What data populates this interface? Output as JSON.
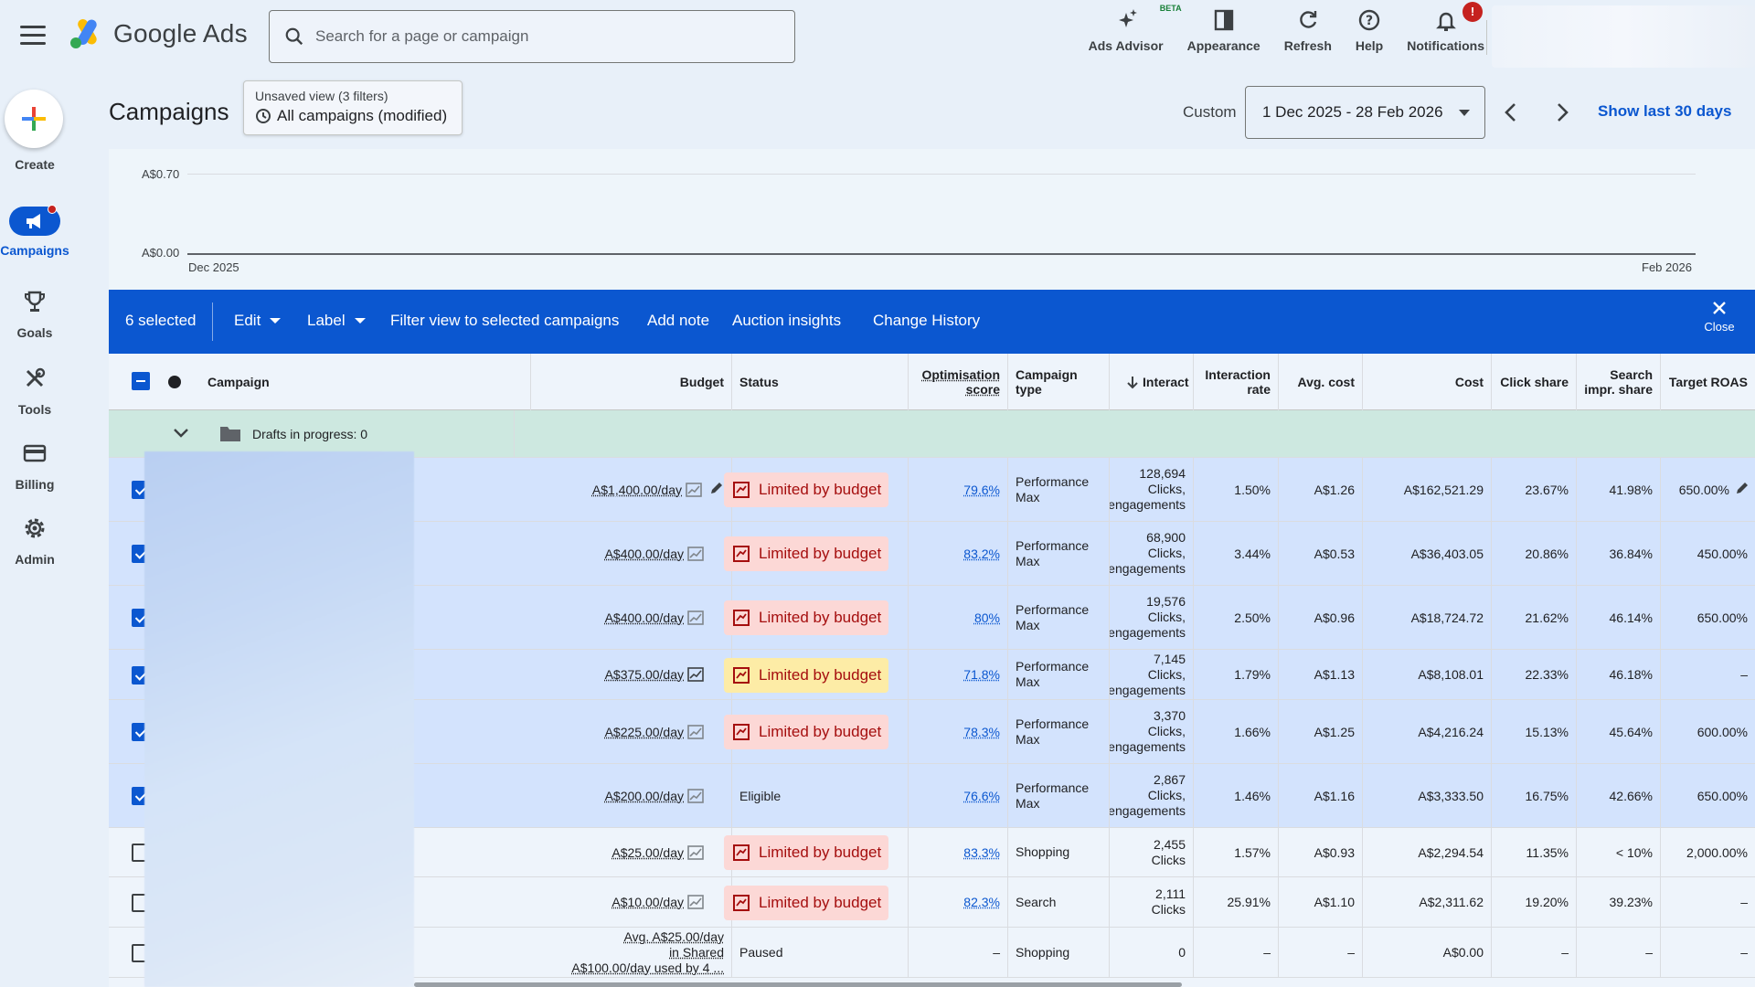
{
  "app": {
    "name": "Google Ads",
    "search_placeholder": "Search for a page or campaign",
    "colors": {
      "accent": "#0b57d0",
      "success": "#137333",
      "error": "#c5221f",
      "drafts_bg": "#cde8e0"
    }
  },
  "top_actions": [
    {
      "label": "Ads Advisor",
      "icon": "sparkle-icon",
      "badge": "BETA"
    },
    {
      "label": "Appearance",
      "icon": "appearance-icon"
    },
    {
      "label": "Refresh",
      "icon": "refresh-icon"
    },
    {
      "label": "Help",
      "icon": "help-icon"
    },
    {
      "label": "Notifications",
      "icon": "bell-icon",
      "badge": "!"
    }
  ],
  "nav": [
    {
      "label": "Create",
      "icon": "plus-icon"
    },
    {
      "label": "Campaigns",
      "icon": "megaphone-icon",
      "active": true
    },
    {
      "label": "Goals",
      "icon": "trophy-icon"
    },
    {
      "label": "Tools",
      "icon": "tools-icon"
    },
    {
      "label": "Billing",
      "icon": "card-icon"
    },
    {
      "label": "Admin",
      "icon": "gear-icon"
    }
  ],
  "header": {
    "title": "Campaigns",
    "view_sub": "Unsaved view (3 filters)",
    "view_main": "All campaigns (modified)",
    "custom_label": "Custom",
    "date_range": "1 Dec 2025 - 28 Feb 2026",
    "show_last": "Show last 30 days"
  },
  "chart": {
    "y_top": "A$0.70",
    "y_bottom": "A$0.00",
    "x_start": "Dec 2025",
    "x_end": "Feb 2026"
  },
  "selection_bar": {
    "count": "6 selected",
    "edit": "Edit",
    "label": "Label",
    "filter": "Filter view to selected campaigns",
    "add_note": "Add note",
    "auction": "Auction insights",
    "history": "Change History",
    "close": "Close"
  },
  "table": {
    "headers": {
      "campaign": "Campaign",
      "budget": "Budget",
      "status": "Status",
      "opt_score_1": "Optimisation",
      "opt_score_2": "score",
      "type_1": "Campaign",
      "type_2": "type",
      "interactions": "Interact",
      "irate_1": "Interaction",
      "irate_2": "rate",
      "avg_cost": "Avg. cost",
      "cost": "Cost",
      "click_share": "Click share",
      "sis_1": "Search",
      "sis_2": "impr. share",
      "troas": "Target ROAS"
    },
    "drafts": "Drafts in progress: 0",
    "rows": [
      {
        "selected": true,
        "budget": "A$1,400.00/day",
        "status": "Limited by budget",
        "status_kind": "error",
        "opt": "79.6%",
        "type": "Performance Max",
        "int_1": "128,694",
        "int_2": "Clicks,",
        "int_3": "engagements",
        "irate": "1.50%",
        "avg": "A$1.26",
        "cost": "A$162,521.29",
        "click_share": "23.67%",
        "sis": "41.98%",
        "troas": "650.00%"
      },
      {
        "selected": true,
        "budget": "A$400.00/day",
        "status": "Limited by budget",
        "status_kind": "error",
        "opt": "83.2%",
        "type": "Performance Max",
        "int_1": "68,900",
        "int_2": "Clicks,",
        "int_3": "engagements",
        "irate": "3.44%",
        "avg": "A$0.53",
        "cost": "A$36,403.05",
        "click_share": "20.86%",
        "sis": "36.84%",
        "troas": "450.00%"
      },
      {
        "selected": true,
        "budget": "A$400.00/day",
        "status": "Limited by budget",
        "status_kind": "error",
        "opt": "80%",
        "type": "Performance Max",
        "int_1": "19,576",
        "int_2": "Clicks,",
        "int_3": "engagements",
        "irate": "2.50%",
        "avg": "A$0.96",
        "cost": "A$18,724.72",
        "click_share": "21.62%",
        "sis": "46.14%",
        "troas": "650.00%"
      },
      {
        "selected": true,
        "budget": "A$375.00/day",
        "status": "Limited by budget",
        "status_kind": "warn",
        "opt": "71.8%",
        "type": "Performance Max",
        "int_1": "7,145",
        "int_2": "Clicks,",
        "int_3": "engagements",
        "irate": "1.79%",
        "avg": "A$1.13",
        "cost": "A$8,108.01",
        "click_share": "22.33%",
        "sis": "46.18%",
        "troas": "–"
      },
      {
        "selected": true,
        "budget": "A$225.00/day",
        "status": "Limited by budget",
        "status_kind": "error",
        "opt": "78.3%",
        "type": "Performance Max",
        "int_1": "3,370",
        "int_2": "Clicks,",
        "int_3": "engagements",
        "irate": "1.66%",
        "avg": "A$1.25",
        "cost": "A$4,216.24",
        "click_share": "15.13%",
        "sis": "45.64%",
        "troas": "600.00%"
      },
      {
        "selected": true,
        "budget": "A$200.00/day",
        "status": "Eligible",
        "status_kind": "plain",
        "opt": "76.6%",
        "type": "Performance Max",
        "int_1": "2,867",
        "int_2": "Clicks,",
        "int_3": "engagements",
        "irate": "1.46%",
        "avg": "A$1.16",
        "cost": "A$3,333.50",
        "click_share": "16.75%",
        "sis": "42.66%",
        "troas": "650.00%"
      },
      {
        "selected": false,
        "budget": "A$25.00/day",
        "status": "Limited by budget",
        "status_kind": "error",
        "opt": "83.3%",
        "type": "Shopping",
        "int_1": "2,455",
        "int_2": "Clicks",
        "int_3": "",
        "irate": "1.57%",
        "avg": "A$0.93",
        "cost": "A$2,294.54",
        "click_share": "11.35%",
        "sis": "< 10%",
        "troas": "2,000.00%"
      },
      {
        "selected": false,
        "budget": "A$10.00/day",
        "status": "Limited by budget",
        "status_kind": "error",
        "opt": "82.3%",
        "type": "Search",
        "int_1": "2,111",
        "int_2": "Clicks",
        "int_3": "",
        "irate": "25.91%",
        "avg": "A$1.10",
        "cost": "A$2,311.62",
        "click_share": "19.20%",
        "sis": "39.23%",
        "troas": "–"
      },
      {
        "selected": false,
        "budget": "Avg. A$25.00/day",
        "budget_2": "in Shared",
        "budget_3": "A$100.00/day used by 4 ...",
        "status": "Paused",
        "status_kind": "plain",
        "opt": "–",
        "type": "Shopping",
        "int_1": "0",
        "int_2": "",
        "int_3": "",
        "irate": "–",
        "avg": "–",
        "cost": "A$0.00",
        "click_share": "–",
        "sis": "–",
        "troas": "–"
      }
    ]
  }
}
